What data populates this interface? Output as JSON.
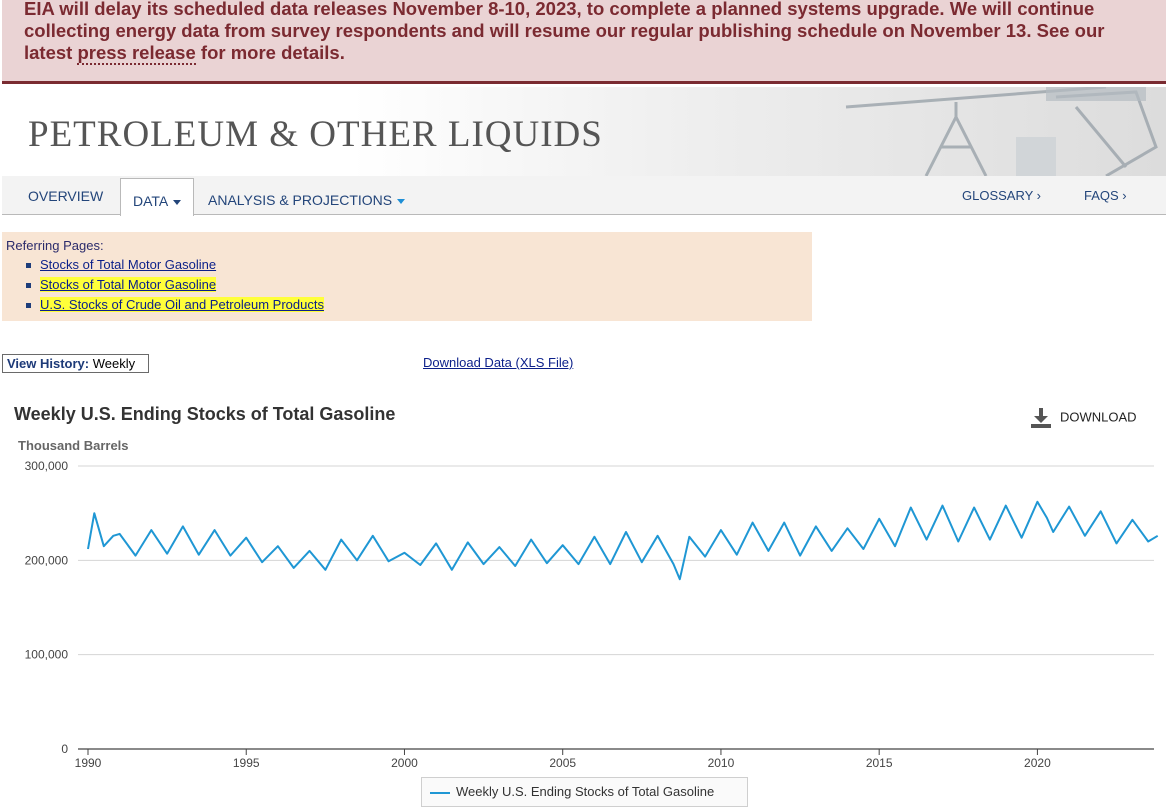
{
  "banner": {
    "text_before": "EIA will delay its scheduled data releases November 8-10, 2023, to complete a planned systems upgrade. We will continue collecting energy data from survey respondents and will resume our regular publishing schedule on November 13. See our latest ",
    "link": "press release",
    "text_after": " for more details."
  },
  "header": {
    "title": "PETROLEUM & OTHER LIQUIDS"
  },
  "nav": {
    "overview": "OVERVIEW",
    "data": "DATA",
    "analysis": "ANALYSIS & PROJECTIONS",
    "glossary": "GLOSSARY ›",
    "faqs": "FAQS ›"
  },
  "referring": {
    "label": "Referring Pages:",
    "items": [
      "Stocks of Total Motor Gasoline",
      "Stocks of Total Motor Gasoline",
      "U.S. Stocks of Crude Oil and Petroleum Products"
    ]
  },
  "history": {
    "label": "View History:",
    "value": "Weekly"
  },
  "download_data": "Download Data (XLS File)",
  "chart": {
    "download": "DOWNLOAD"
  },
  "colors": {
    "series": "#1f97d4",
    "banner_text": "#7b2a31",
    "link": "#0b1f8a",
    "highlight": "#ffff3a"
  },
  "chart_data": {
    "type": "line",
    "title": "Weekly U.S. Ending Stocks of Total Gasoline",
    "ylabel": "Thousand Barrels",
    "ylim": [
      0,
      300000
    ],
    "xlim": [
      1990,
      2024
    ],
    "yticks": [
      "0",
      "100,000",
      "200,000",
      "300,000"
    ],
    "yticks_values": [
      0,
      100000,
      200000,
      300000
    ],
    "xticks": [
      "1990",
      "1995",
      "2000",
      "2005",
      "2010",
      "2015",
      "2020"
    ],
    "grid": true,
    "legend": "bottom-center",
    "series": [
      {
        "name": "Weekly U.S. Ending Stocks of Total Gasoline",
        "x": [
          1990.0,
          1990.2,
          1990.5,
          1990.8,
          1991.0,
          1991.5,
          1992.0,
          1992.5,
          1993.0,
          1993.5,
          1994.0,
          1994.5,
          1995.0,
          1995.5,
          1996.0,
          1996.5,
          1997.0,
          1997.5,
          1998.0,
          1998.5,
          1999.0,
          1999.5,
          2000.0,
          2000.5,
          2001.0,
          2001.5,
          2002.0,
          2002.5,
          2003.0,
          2003.5,
          2004.0,
          2004.5,
          2005.0,
          2005.5,
          2006.0,
          2006.5,
          2007.0,
          2007.5,
          2008.0,
          2008.5,
          2008.7,
          2009.0,
          2009.5,
          2010.0,
          2010.5,
          2011.0,
          2011.5,
          2012.0,
          2012.5,
          2013.0,
          2013.5,
          2014.0,
          2014.5,
          2015.0,
          2015.5,
          2016.0,
          2016.5,
          2017.0,
          2017.5,
          2018.0,
          2018.5,
          2019.0,
          2019.5,
          2020.0,
          2020.3,
          2020.5,
          2021.0,
          2021.5,
          2022.0,
          2022.5,
          2023.0,
          2023.5,
          2023.8
        ],
        "values": [
          212000,
          250000,
          215000,
          226000,
          228000,
          205000,
          232000,
          207000,
          236000,
          206000,
          232000,
          205000,
          224000,
          198000,
          215000,
          192000,
          210000,
          190000,
          222000,
          200000,
          226000,
          199000,
          208000,
          195000,
          218000,
          190000,
          219000,
          196000,
          214000,
          194000,
          222000,
          197000,
          216000,
          196000,
          225000,
          196000,
          230000,
          198000,
          226000,
          196000,
          180000,
          225000,
          204000,
          232000,
          206000,
          240000,
          210000,
          240000,
          205000,
          236000,
          210000,
          234000,
          212000,
          244000,
          215000,
          256000,
          222000,
          258000,
          220000,
          256000,
          222000,
          258000,
          224000,
          262000,
          245000,
          230000,
          257000,
          226000,
          252000,
          218000,
          243000,
          220000,
          226000
        ]
      }
    ]
  }
}
